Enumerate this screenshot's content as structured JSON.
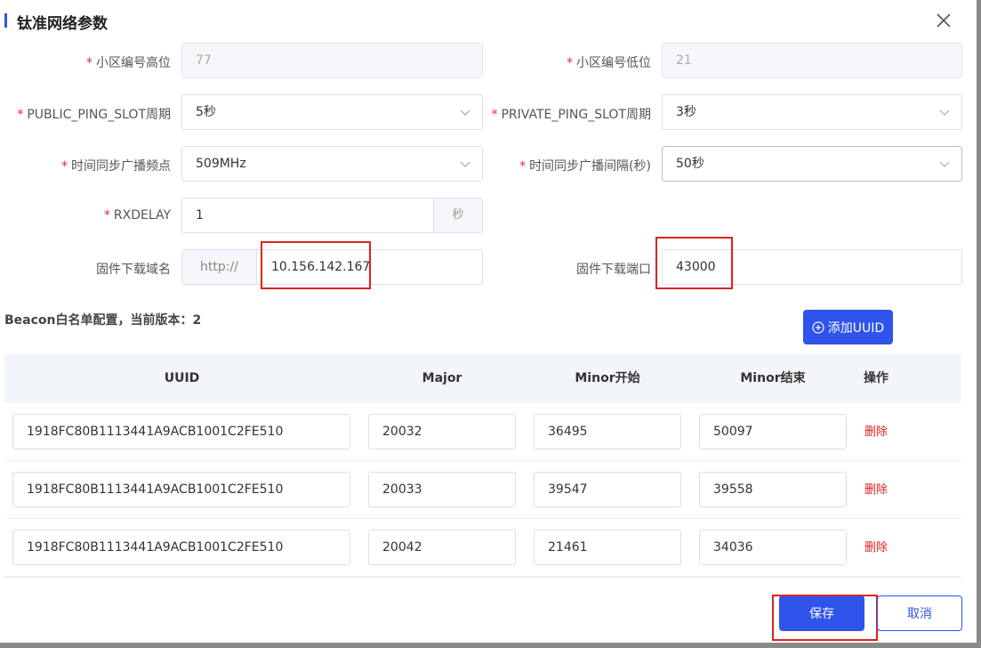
{
  "dialog": {
    "title": "钛准网络参数",
    "close_icon": "close-icon",
    "accent_color": "#2f54eb"
  },
  "form": {
    "cell_high": {
      "label": "小区编号高位",
      "value": "77",
      "required": "*"
    },
    "cell_low": {
      "label": "小区编号低位",
      "value": "21",
      "required": "*"
    },
    "public_ping": {
      "label": "PUBLIC_PING_SLOT周期",
      "value": "5秒",
      "required": "*"
    },
    "private_ping": {
      "label": "PRIVATE_PING_SLOT周期",
      "value": "3秒",
      "required": "*"
    },
    "time_sync_freq": {
      "label": "时间同步广播频点",
      "value": "509MHz",
      "required": "*"
    },
    "time_sync_interval": {
      "label": "时间同步广播间隔(秒)",
      "value": "50秒",
      "required": "*"
    },
    "rxdelay": {
      "label": "RXDELAY",
      "value": "1",
      "suffix": "秒",
      "required": "*"
    },
    "fw_domain": {
      "label": "固件下载域名",
      "prefix": "http://",
      "value": "10.156.142.167"
    },
    "fw_port": {
      "label": "固件下载端口",
      "value": "43000"
    }
  },
  "beacon": {
    "section_title": "Beacon白名单配置，当前版本：2",
    "add_button_label": "添加UUID",
    "columns": [
      "UUID",
      "Major",
      "Minor开始",
      "Minor结束",
      "操作"
    ],
    "delete_label": "删除",
    "rows": [
      {
        "uuid": "1918FC80B1113441A9ACB1001C2FE510",
        "major": "20032",
        "minor_start": "36495",
        "minor_end": "50097"
      },
      {
        "uuid": "1918FC80B1113441A9ACB1001C2FE510",
        "major": "20033",
        "minor_start": "39547",
        "minor_end": "39558"
      },
      {
        "uuid": "1918FC80B1113441A9ACB1001C2FE510",
        "major": "20042",
        "minor_start": "21461",
        "minor_end": "34036"
      }
    ]
  },
  "footer": {
    "save_label": "保存",
    "cancel_label": "取消"
  }
}
